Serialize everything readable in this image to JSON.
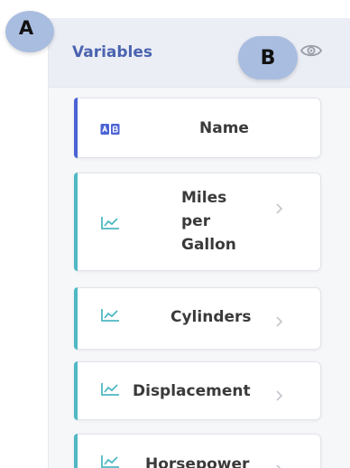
{
  "panel": {
    "title": "Variables",
    "toggle_icon": "eye-icon"
  },
  "annotations": {
    "a": "A",
    "b": "B"
  },
  "colors": {
    "title": "#4a63b0",
    "categorical_accent": "#4a63d4",
    "quantitative_accent": "#4fb8c4",
    "badge": "#a9bde0"
  },
  "variables": [
    {
      "label": "Name",
      "type_icon": "categorical-icon",
      "expandable": false
    },
    {
      "label": "Miles per Gallon",
      "type_icon": "line-chart-icon",
      "expandable": true
    },
    {
      "label": "Cylinders",
      "type_icon": "line-chart-icon",
      "expandable": true
    },
    {
      "label": "Displacement",
      "type_icon": "line-chart-icon",
      "expandable": true
    },
    {
      "label": "Horsepower",
      "type_icon": "line-chart-icon",
      "expandable": true
    }
  ]
}
